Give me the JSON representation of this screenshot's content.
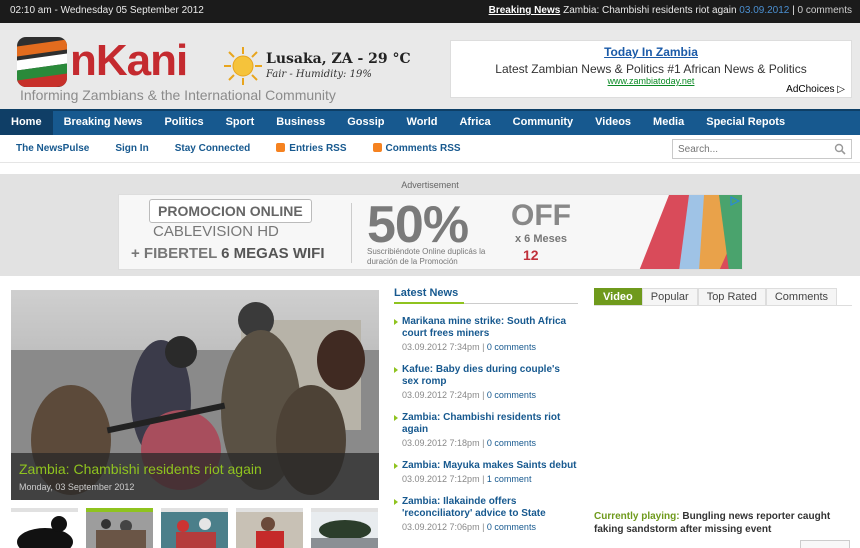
{
  "topbar": {
    "datetime": "02:10 am - Wednesday 05 September 2012",
    "breaking_label": "Breaking News",
    "breaking_headline": "Zambia: Chambishi residents riot again",
    "breaking_date": "03.09.2012",
    "breaking_comments": "0 comments"
  },
  "header": {
    "logo_text": "nKani",
    "tagline": "Informing Zambians & the International Community",
    "weather": {
      "city": "Lusaka, ZA - 29 °C",
      "desc": "Fair - Humidity: 19%"
    },
    "ad": {
      "title": "Today In Zambia",
      "desc": "Latest Zambian News & Politics #1 African News & Politics",
      "url": "www.zambiatoday.net",
      "adchoices": "AdChoices"
    }
  },
  "nav": {
    "items": [
      {
        "label": "Home"
      },
      {
        "label": "Breaking News"
      },
      {
        "label": "Politics"
      },
      {
        "label": "Sport"
      },
      {
        "label": "Business"
      },
      {
        "label": "Gossip"
      },
      {
        "label": "World"
      },
      {
        "label": "Africa"
      },
      {
        "label": "Community"
      },
      {
        "label": "Videos"
      },
      {
        "label": "Media"
      },
      {
        "label": "Special Repots"
      }
    ]
  },
  "subnav": {
    "links": [
      "The NewsPulse",
      "Sign In",
      "Stay Connected",
      "Entries RSS",
      "Comments RSS"
    ],
    "search_placeholder": "Search..."
  },
  "advert": {
    "label": "Advertisement",
    "promo": "PROMOCION ONLINE",
    "cable": "CABLEVISION HD",
    "fiber_prefix": "+ FIBERTEL ",
    "fiber_highlight": "6 MEGAS WIFI",
    "percent": "50%",
    "off": "OFF",
    "meses": "x 6 Meses",
    "twelve": "12",
    "fine_print": "Suscribiéndote Online duplicás la duración de la Promoción"
  },
  "feature": {
    "title": "Zambia: Chambishi residents riot again",
    "date": "Monday, 03 September 2012"
  },
  "latest": {
    "heading": "Latest News",
    "items": [
      {
        "title": "Marikana mine strike: South Africa court frees miners",
        "date": "03.09.2012 7:34pm",
        "comments": "0 comments"
      },
      {
        "title": "Kafue: Baby dies during couple's sex romp",
        "date": "03.09.2012 7:24pm",
        "comments": "0 comments"
      },
      {
        "title": "Zambia: Chambishi residents riot again",
        "date": "03.09.2012 7:18pm",
        "comments": "0 comments"
      },
      {
        "title": "Zambia: Mayuka makes Saints debut",
        "date": "03.09.2012 7:12pm",
        "comments": "1 comment"
      },
      {
        "title": "Zambia: Ilakainde offers 'reconciliatory' advice to State",
        "date": "03.09.2012 7:06pm",
        "comments": "0 comments"
      }
    ]
  },
  "sidebar": {
    "tabs": [
      "Video",
      "Popular",
      "Top Rated",
      "Comments"
    ],
    "playing_label": "Currently playing:",
    "playing_title": "Bungling news reporter caught faking sandstorm after missing event"
  }
}
